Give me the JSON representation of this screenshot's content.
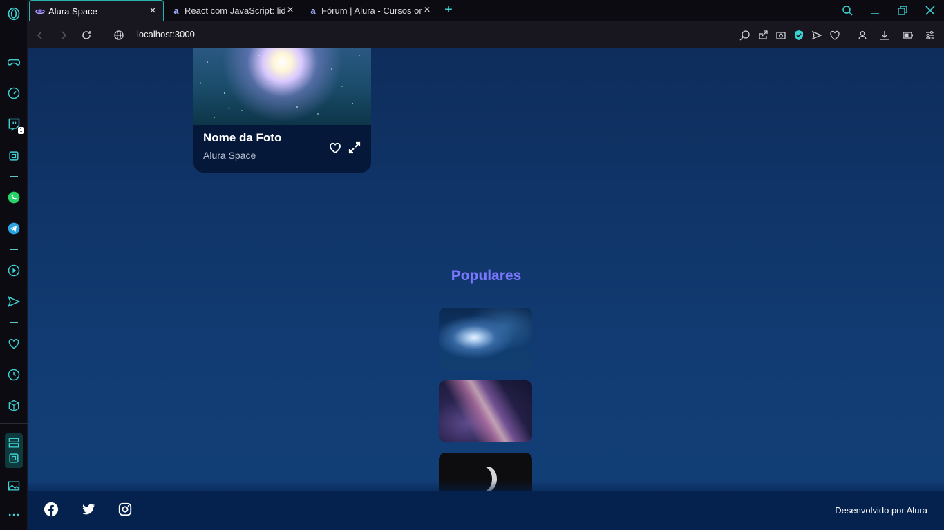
{
  "browser": {
    "tabs": [
      {
        "title": "Alura Space",
        "active": true
      },
      {
        "title": "React com JavaScript: lidand",
        "active": false
      },
      {
        "title": "Fórum | Alura - Cursos onlin",
        "active": false
      }
    ],
    "url": "localhost:3000",
    "sidebar_badge": "1"
  },
  "page": {
    "card": {
      "title": "Nome da Foto",
      "subtitle": "Alura Space"
    },
    "populares_title": "Populares",
    "footer": {
      "credit": "Desenvolvido por Alura",
      "social_icons": [
        "facebook-icon",
        "twitter-icon",
        "instagram-icon"
      ]
    }
  },
  "colors": {
    "accent": "#27b3b3",
    "page_bg": "#113b72",
    "populares_title": "#7b78ff",
    "footer_bg": "#04224d"
  }
}
